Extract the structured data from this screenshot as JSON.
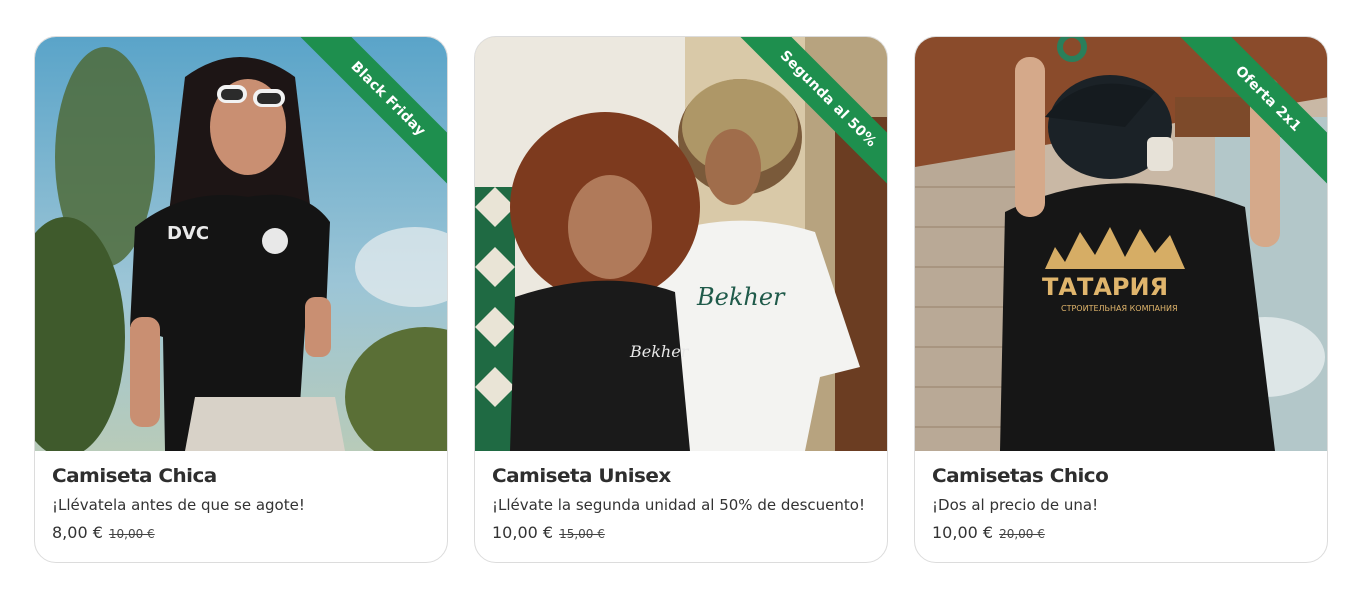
{
  "products": [
    {
      "ribbon": "Black Friday",
      "title": "Camiseta Chica",
      "subtitle": "¡Llévatela antes de que se agote!",
      "price": "8,00 €",
      "old_price": "10,00 €",
      "print_text": "DVC"
    },
    {
      "ribbon": "Segunda al 50%",
      "title": "Camiseta Unisex",
      "subtitle": "¡Llévate la segunda unidad al 50% de descuento!",
      "price": "10,00 €",
      "old_price": "15,00 €",
      "print_text": "Bekher"
    },
    {
      "ribbon": "Oferta 2x1",
      "title": "Camisetas Chico",
      "subtitle": "¡Dos al precio de una!",
      "price": "10,00 €",
      "old_price": "20,00 €",
      "print_text": "ТАТАРИЯ",
      "print_subtext": "СТРОИТЕЛЬНАЯ КОМПАНИЯ"
    }
  ],
  "colors": {
    "ribbon": "#1e8f4e",
    "border": "#dcdcdc"
  }
}
